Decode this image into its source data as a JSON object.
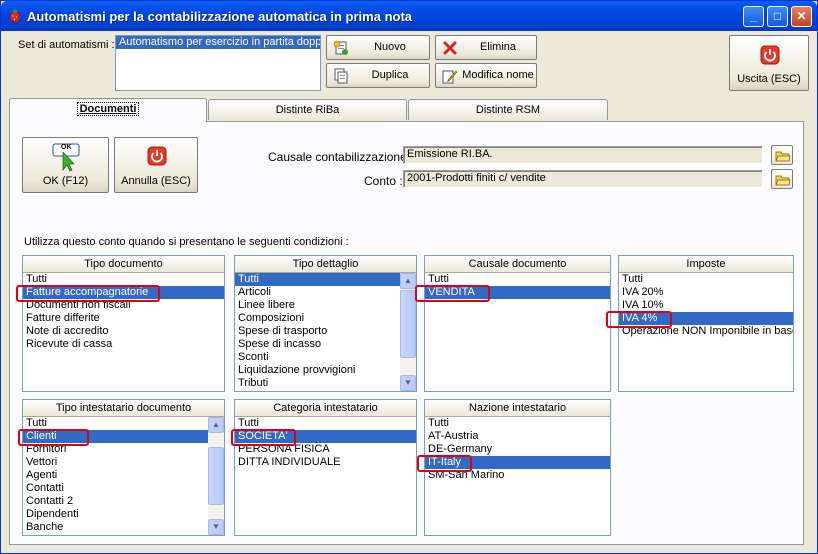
{
  "window": {
    "title": "Automatismi per la contabilizzazione automatica in prima nota",
    "controls": {
      "minimize": "_",
      "maximize": "□",
      "close": "✕"
    }
  },
  "header": {
    "set_label": "Set di automatismi :",
    "set_items": [
      "Automatismo per esercizio in partita doppia"
    ],
    "buttons": {
      "nuovo": "Nuovo",
      "elimina": "Elimina",
      "duplica": "Duplica",
      "modifica_nome": "Modifica nome",
      "uscita": "Uscita (ESC)"
    }
  },
  "tabs": [
    {
      "label": "Documenti",
      "active": true
    },
    {
      "label": "Distinte RiBa",
      "active": false
    },
    {
      "label": "Distinte RSM",
      "active": false
    }
  ],
  "panel": {
    "ok_label": "OK (F12)",
    "ok_badge": "OK",
    "annulla_label": "Annulla (ESC)",
    "causale_label": "Causale contabilizzazione :",
    "causale_value": "Emissione RI.BA.",
    "conto_label": "Conto :",
    "conto_value": "2001-Prodotti finiti c/ vendite",
    "conditions_text": "Utilizza questo conto quando si presentano le seguenti condizioni :"
  },
  "groups": {
    "tipo_documento": {
      "title": "Tipo documento",
      "items": [
        "Tutti",
        "Fatture accompagnatorie",
        "Documenti non fiscali",
        "Fatture differite",
        "Note di accredito",
        "Ricevute di cassa"
      ],
      "selected": 1
    },
    "tipo_dettaglio": {
      "title": "Tipo dettaglio",
      "items": [
        "Tutti",
        "Articoli",
        "Linee libere",
        "Composizioni",
        "Spese di trasporto",
        "Spese di incasso",
        "Sconti",
        "Liquidazione provvigioni",
        "Tributi"
      ],
      "selected": 0
    },
    "causale_documento": {
      "title": "Causale documento",
      "items": [
        "Tutti",
        "VENDITA"
      ],
      "selected": 1
    },
    "imposte": {
      "title": "Imposte",
      "items": [
        "Tutti",
        "IVA 20%",
        "IVA 10%",
        "IVA 4%",
        "Operazione NON Imponibile in base"
      ],
      "selected": 3
    },
    "tipo_intestatario": {
      "title": "Tipo intestatario documento",
      "items": [
        "Tutti",
        "Clienti",
        "Fornitori",
        "Vettori",
        "Agenti",
        "Contatti",
        "Contatti 2",
        "Dipendenti",
        "Banche"
      ],
      "selected": 1
    },
    "categoria_intestatario": {
      "title": "Categoria intestatario",
      "items": [
        "Tutti",
        "SOCIETA'",
        "PERSONA FISICA",
        "DITTA INDIVIDUALE"
      ],
      "selected": 1
    },
    "nazione_intestatario": {
      "title": "Nazione intestatario",
      "items": [
        "Tutti",
        "AT-Austria",
        "DE-Germany",
        "IT-Italy",
        "SM-San Marino"
      ],
      "selected": 3
    }
  },
  "icons": {
    "app": "strawberry-icon",
    "nuovo": "new-document-icon",
    "elimina": "red-x-icon",
    "duplica": "copy-icon",
    "modifica_nome": "edit-pencil-icon",
    "uscita": "power-icon",
    "ok": "ok-arrow-icon",
    "annulla": "power-icon",
    "folder": "folder-icon"
  },
  "colors": {
    "selection": "#316ac5",
    "highlight": "#e00010",
    "titlebar": "#0048e0",
    "face": "#ece9d8"
  }
}
